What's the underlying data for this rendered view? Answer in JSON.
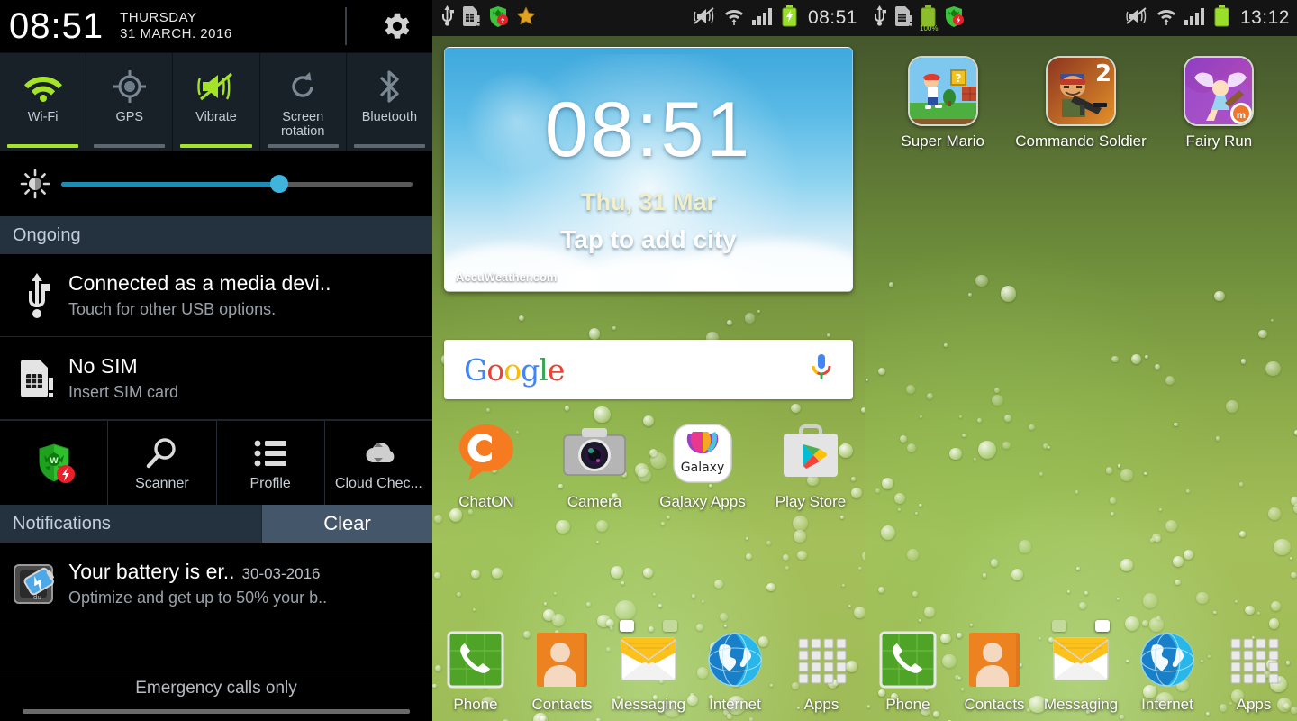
{
  "notification_shade": {
    "header": {
      "time": "08:51",
      "day_of_week": "THURSDAY",
      "date": "31 MARCH. 2016",
      "settings_icon": "gear-icon"
    },
    "quick_settings": [
      {
        "label": "Wi-Fi",
        "icon": "wifi-icon",
        "active": true
      },
      {
        "label": "GPS",
        "icon": "gps-icon",
        "active": false
      },
      {
        "label": "Vibrate",
        "icon": "vibrate-icon",
        "active": true
      },
      {
        "label": "Screen rotation",
        "icon": "rotate-icon",
        "active": false
      },
      {
        "label": "Bluetooth",
        "icon": "bluetooth-icon",
        "active": false
      }
    ],
    "brightness": {
      "icon": "brightness-icon",
      "value": 62
    },
    "ongoing_title": "Ongoing",
    "ongoing": [
      {
        "icon": "usb-icon",
        "title": "Connected as a media devi..",
        "subtitle": "Touch for other USB options."
      },
      {
        "icon": "sim-card-icon",
        "title": "No SIM",
        "subtitle": "Insert SIM card"
      }
    ],
    "tools": [
      {
        "label": "",
        "icon": "drweb-shield-icon"
      },
      {
        "label": "Scanner",
        "icon": "magnifier-icon"
      },
      {
        "label": "Profile",
        "icon": "list-icon"
      },
      {
        "label": "Cloud Chec...",
        "icon": "cloud-check-icon"
      }
    ],
    "notifications_title": "Notifications",
    "clear_label": "Clear",
    "notifications": [
      {
        "icon": "battery-boost-icon",
        "title": "Your battery is er..",
        "when": "30-03-2016",
        "subtitle": "Optimize and get up to 50% your b.."
      }
    ],
    "emergency_text": "Emergency calls only"
  },
  "home_center": {
    "statusbar": {
      "left_icons": [
        "usb-icon",
        "sim-card-icon",
        "drweb-shield-icon",
        "star-icon"
      ],
      "right_icons": [
        "mute-vibrate-icon",
        "wifi-icon",
        "signal-icon",
        "battery-charging-icon"
      ],
      "time": "08:51"
    },
    "clock_widget": {
      "time": "08:51",
      "date": "Thu, 31 Mar",
      "city_prompt": "Tap to add city",
      "attribution": "AccuWeather.com"
    },
    "search": {
      "logo": "Google",
      "logo_letters": [
        "G",
        "o",
        "o",
        "g",
        "l",
        "e"
      ],
      "mic_icon": "microphone-icon"
    },
    "apps": [
      {
        "label": "ChatON",
        "icon": "chaton-icon"
      },
      {
        "label": "Camera",
        "icon": "camera-icon"
      },
      {
        "label": "Galaxy Apps",
        "icon": "galaxy-apps-icon"
      },
      {
        "label": "Play Store",
        "icon": "play-store-icon"
      }
    ],
    "page_dots": {
      "count": 2,
      "active": 0
    },
    "dock": [
      {
        "label": "Phone",
        "icon": "phone-icon"
      },
      {
        "label": "Contacts",
        "icon": "contacts-icon"
      },
      {
        "label": "Messaging",
        "icon": "messaging-icon"
      },
      {
        "label": "Internet",
        "icon": "internet-icon"
      },
      {
        "label": "Apps",
        "icon": "apps-grid-icon"
      }
    ]
  },
  "home_right": {
    "statusbar": {
      "left_icons": [
        "usb-icon",
        "sim-card-icon",
        "battery-100-icon",
        "drweb-shield-icon"
      ],
      "battery_label": "100%",
      "right_icons": [
        "mute-vibrate-icon",
        "wifi-icon",
        "signal-icon",
        "battery-icon"
      ],
      "time": "13:12"
    },
    "games": [
      {
        "label": "Super Mario",
        "icon": "super-mario-icon"
      },
      {
        "label": "Commando Soldier",
        "icon": "commando-soldier-icon"
      },
      {
        "label": "Fairy Run",
        "icon": "fairy-run-icon"
      }
    ],
    "page_dots": {
      "count": 2,
      "active": 1
    },
    "dock": [
      {
        "label": "Phone",
        "icon": "phone-icon"
      },
      {
        "label": "Contacts",
        "icon": "contacts-icon"
      },
      {
        "label": "Messaging",
        "icon": "messaging-icon"
      },
      {
        "label": "Internet",
        "icon": "internet-icon"
      },
      {
        "label": "Apps",
        "icon": "apps-grid-icon"
      }
    ]
  },
  "colors": {
    "accent_green": "#a4e32a",
    "slider_blue": "#1f8bb5",
    "slider_knob": "#3fb4dd",
    "panel_bg": "#182028",
    "section_header": "#243240",
    "clear_button": "#44566a"
  }
}
